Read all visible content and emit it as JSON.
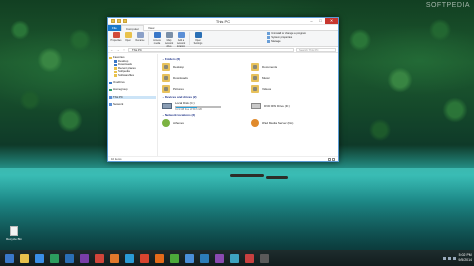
{
  "watermark": "SOFTPEDIA",
  "desktop_icon": {
    "label": "Recycle Bin"
  },
  "window": {
    "title": "This PC",
    "tabs": [
      "File",
      "Computer",
      "View"
    ],
    "ribbon": {
      "buttons": [
        "Properties",
        "Open",
        "Rename",
        "Access media",
        "Map network drive",
        "Add a network location",
        "Open Settings"
      ],
      "system": [
        "Uninstall or change a program",
        "System properties",
        "Manage"
      ]
    },
    "address": "This PC",
    "search_placeholder": "Search This PC",
    "nav": {
      "items": [
        {
          "label": "Favorites",
          "level": 0,
          "color": "#e9c24c"
        },
        {
          "label": "Desktop",
          "level": 1,
          "color": "#3a78c8"
        },
        {
          "label": "Downloads",
          "level": 1,
          "color": "#3a78c8"
        },
        {
          "label": "Recent places",
          "level": 1,
          "color": "#e9c24c"
        },
        {
          "label": "Softpedia",
          "level": 1,
          "color": "#e9c24c"
        },
        {
          "label": "Softwarefiles",
          "level": 1,
          "color": "#e9c24c"
        },
        {
          "label": "",
          "level": 1,
          "color": ""
        },
        {
          "label": "OneDrive",
          "level": 0,
          "color": "#3a78c8"
        },
        {
          "label": "",
          "level": 1,
          "color": ""
        },
        {
          "label": "Homegroup",
          "level": 0,
          "color": "#2d9d6b"
        },
        {
          "label": "",
          "level": 1,
          "color": ""
        },
        {
          "label": "This PC",
          "level": 0,
          "color": "#5b8fd6",
          "selected": true
        },
        {
          "label": "",
          "level": 1,
          "color": ""
        },
        {
          "label": "Network",
          "level": 0,
          "color": "#5b8fd6"
        }
      ]
    },
    "sections": {
      "folders": {
        "title": "Folders (6)",
        "items": [
          "Desktop",
          "Documents",
          "Downloads",
          "Music",
          "Pictures",
          "Videos"
        ]
      },
      "devices": {
        "title": "Devices and drives (2)",
        "items": [
          {
            "label": "Local Disk (C:)",
            "detail": "31.9 GB free of 59.6 GB",
            "used_fraction": 0.47
          },
          {
            "label": "DVD RW Drive (D:)",
            "detail": ""
          }
        ]
      },
      "network": {
        "title": "Network locations (2)",
        "items": [
          "Athenex",
          "iPad Media Server (Do)"
        ]
      }
    },
    "status": "10 items"
  },
  "taskbar": {
    "icons": [
      {
        "name": "start",
        "color": "#3a78c8"
      },
      {
        "name": "explorer",
        "color": "#e9c24c"
      },
      {
        "name": "ie",
        "color": "#3a8ee6"
      },
      {
        "name": "store",
        "color": "#2c9d5e"
      },
      {
        "name": "mail",
        "color": "#2a6fb5"
      },
      {
        "name": "photos",
        "color": "#7a3ea8"
      },
      {
        "name": "media",
        "color": "#d2453a"
      },
      {
        "name": "music",
        "color": "#e2792c"
      },
      {
        "name": "skype",
        "color": "#2a9bd6"
      },
      {
        "name": "chrome",
        "color": "#d9442f"
      },
      {
        "name": "firefox",
        "color": "#e56b1a"
      },
      {
        "name": "utorrent",
        "color": "#4caa3a"
      },
      {
        "name": "app1",
        "color": "#4a8fd8"
      },
      {
        "name": "app2",
        "color": "#2c7db8"
      },
      {
        "name": "app3",
        "color": "#8a4ab0"
      },
      {
        "name": "app4",
        "color": "#3ea3c0"
      },
      {
        "name": "app5",
        "color": "#c84040"
      },
      {
        "name": "app6",
        "color": "#5a5a5a"
      }
    ],
    "time": "5:02 PM",
    "date": "9/5/2014"
  }
}
